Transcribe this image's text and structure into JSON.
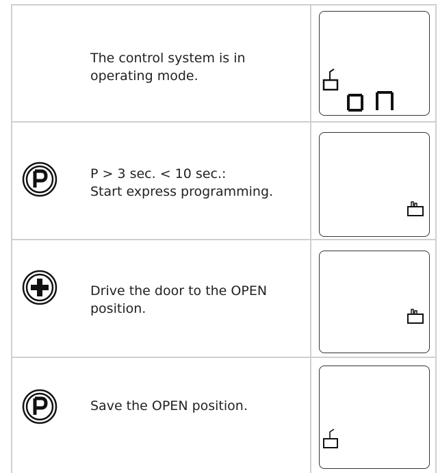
{
  "rows": [
    {
      "text_lines": [
        "The control system is in",
        "operating mode."
      ],
      "button_icon": "none",
      "display_icon": "door-limit-open-icon",
      "display_text": "on"
    },
    {
      "text_lines": [
        "P > 3 sec. < 10 sec.:",
        "Start express programming."
      ],
      "button_icon": "p-button-icon",
      "display_icon": "door-hand-icon",
      "display_text": ""
    },
    {
      "text_lines": [
        "Drive the door to the OPEN",
        "position."
      ],
      "button_icon": "plus-button-icon",
      "display_icon": "door-hand-icon",
      "display_text": ""
    },
    {
      "text_lines": [
        "Save the OPEN position."
      ],
      "button_icon": "p-button-icon",
      "display_icon": "door-limit-open-icon",
      "display_text": ""
    }
  ],
  "colors": {
    "border": "#cfcfcf",
    "ink": "#1f1f1f"
  }
}
